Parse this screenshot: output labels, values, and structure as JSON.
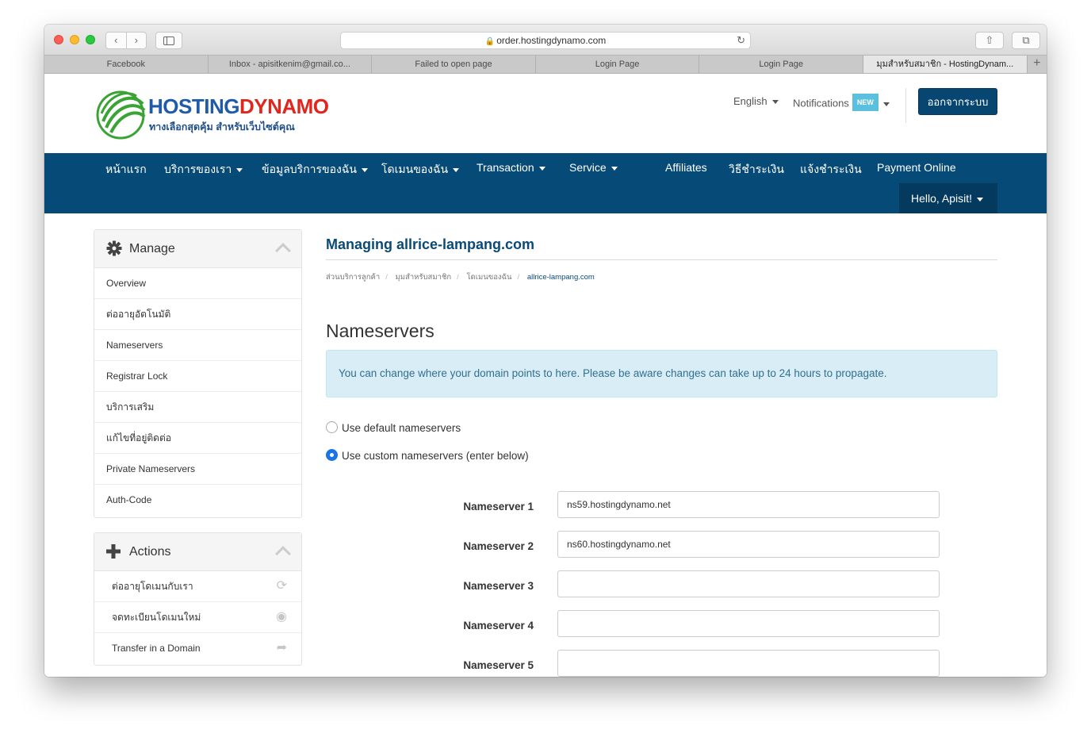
{
  "browser": {
    "url": "order.hostingdynamo.com",
    "tabs": [
      {
        "title": "Facebook"
      },
      {
        "title": "Inbox - apisitkenim@gmail.co..."
      },
      {
        "title": "Failed to open page"
      },
      {
        "title": "Login Page"
      },
      {
        "title": "Login Page"
      },
      {
        "title": "มุมสำหรับสมาชิก - HostingDynam..."
      }
    ],
    "new_tab": "+"
  },
  "header": {
    "logo_part1": "HOSTING",
    "logo_part2": "DYNAMO",
    "logo_tagline": "ทางเลือกสุดคุ้ม สำหรับเว็บไซต์คุณ",
    "language": "English",
    "notifications": "Notifications",
    "new_badge": "NEW",
    "logout": "ออกจากระบบ"
  },
  "nav": {
    "items": [
      {
        "label": "หน้าแรก"
      },
      {
        "label": "บริการของเรา"
      },
      {
        "label": "ข้อมูลบริการของฉัน"
      },
      {
        "label": "โดเมนของฉัน"
      },
      {
        "label": "Transaction"
      },
      {
        "label": "Service"
      },
      {
        "label": "Affiliates"
      },
      {
        "label": "วิธีชำระเงิน"
      },
      {
        "label": "แจ้งชำระเงิน"
      },
      {
        "label": "Payment Online"
      }
    ],
    "hello": "Hello, Apisit!"
  },
  "sidebar": {
    "manage_title": "Manage",
    "manage_items": [
      {
        "label": "Overview"
      },
      {
        "label": "ต่ออายุอัตโนมัติ"
      },
      {
        "label": "Nameservers"
      },
      {
        "label": "Registrar Lock"
      },
      {
        "label": "บริการเสริม"
      },
      {
        "label": "แก้ไขที่อยู่ติดต่อ"
      },
      {
        "label": "Private Nameservers"
      },
      {
        "label": "Auth-Code"
      }
    ],
    "actions_title": "Actions",
    "action_items": [
      {
        "label": "ต่ออายุโดเมนกับเรา",
        "icon": "refresh-icon"
      },
      {
        "label": "จดทะเบียนโดเมนใหม่",
        "icon": "globe-icon"
      },
      {
        "label": "Transfer in a Domain",
        "icon": "share-arrow-icon"
      }
    ]
  },
  "content": {
    "title": "Managing allrice-lampang.com",
    "breadcrumb": [
      "ส่วนบริการลูกค้า",
      "มุมสำหรับสมาชิก",
      "โดเมนของฉัน",
      "allrice-lampang.com"
    ],
    "heading": "Nameservers",
    "alert": "You can change where your domain points to here. Please be aware changes can take up to 24 hours to propagate.",
    "radio_default": "Use default nameservers",
    "radio_custom": "Use custom nameservers (enter below)",
    "selected_option": "custom",
    "nameservers": [
      {
        "label": "Nameserver 1",
        "value": "ns59.hostingdynamo.net"
      },
      {
        "label": "Nameserver 2",
        "value": "ns60.hostingdynamo.net"
      },
      {
        "label": "Nameserver 3",
        "value": ""
      },
      {
        "label": "Nameserver 4",
        "value": ""
      },
      {
        "label": "Nameserver 5",
        "value": ""
      }
    ]
  },
  "colors": {
    "nav_bg": "#064b77",
    "hello_bg": "#043a5e",
    "title_blue": "#0a4a75",
    "alert_bg": "#d9edf7",
    "alert_text": "#31708f",
    "badge": "#5bc0de"
  }
}
